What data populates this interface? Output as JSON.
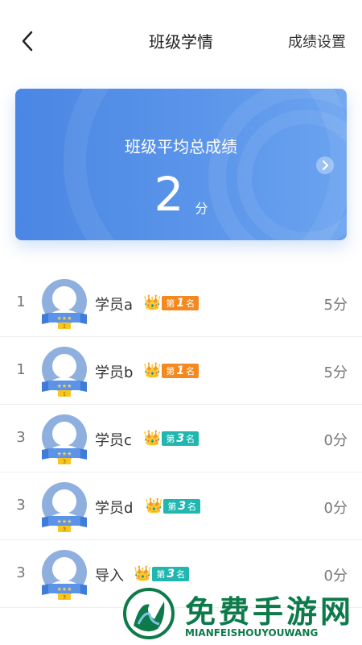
{
  "header": {
    "title": "班级学情",
    "settings_label": "成绩设置",
    "back_icon": "chevron-left-icon"
  },
  "summary": {
    "label": "班级平均总成绩",
    "score": "2",
    "unit": "分"
  },
  "students": [
    {
      "rank": "1",
      "name": "学员a",
      "badge_prefix": "第",
      "badge_num": "1",
      "badge_suffix": "名",
      "badge_color": "#f5891f",
      "score": "5分",
      "medal_num": "1"
    },
    {
      "rank": "1",
      "name": "学员b",
      "badge_prefix": "第",
      "badge_num": "1",
      "badge_suffix": "名",
      "badge_color": "#f5891f",
      "score": "5分",
      "medal_num": "1"
    },
    {
      "rank": "3",
      "name": "学员c",
      "badge_prefix": "第",
      "badge_num": "3",
      "badge_suffix": "名",
      "badge_color": "#21b7b0",
      "score": "0分",
      "medal_num": "3"
    },
    {
      "rank": "3",
      "name": "学员d",
      "badge_prefix": "第",
      "badge_num": "3",
      "badge_suffix": "名",
      "badge_color": "#21b7b0",
      "score": "0分",
      "medal_num": "3"
    },
    {
      "rank": "3",
      "name": "导入",
      "badge_prefix": "第",
      "badge_num": "3",
      "badge_suffix": "名",
      "badge_color": "#21b7b0",
      "score": "0分",
      "medal_num": "3"
    }
  ],
  "watermark": {
    "title": "免费手游网",
    "subtitle": "MIANFEISHOUYOUWANG"
  },
  "colors": {
    "card": "#4a86e3",
    "badge_first": "#f5891f",
    "badge_third": "#21b7b0",
    "watermark": "#0d7a4a"
  }
}
